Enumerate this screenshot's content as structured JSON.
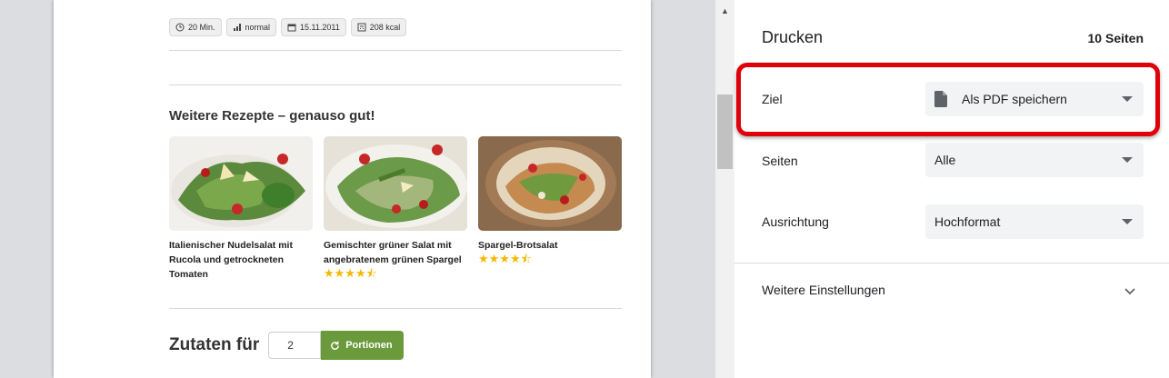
{
  "recipe_page": {
    "meta": [
      {
        "icon": "clock-icon",
        "text": "20 Min."
      },
      {
        "icon": "bars-icon",
        "text": "normal"
      },
      {
        "icon": "calendar-icon",
        "text": "15.11.2011"
      },
      {
        "icon": "calc-icon",
        "text": "208 kcal"
      }
    ],
    "more_recipes_title": "Weitere Rezepte – genauso gut!",
    "recipes": [
      {
        "title": "Italienischer Nudelsalat mit Rucola und getrockneten Tomaten",
        "stars": ""
      },
      {
        "title": "Gemischter grüner Salat mit angebratenem grünen Spargel",
        "stars": "★★★★⯪"
      },
      {
        "title": "Spargel-Brotsalat",
        "stars": "★★★★⯪"
      }
    ],
    "ingredients_label": "Zutaten für",
    "portions_value": "2",
    "portions_button": "Portionen"
  },
  "print_panel": {
    "title": "Drucken",
    "page_count": "10 Seiten",
    "destination_label": "Ziel",
    "destination_value": "Als PDF speichern",
    "pages_label": "Seiten",
    "pages_value": "Alle",
    "orientation_label": "Ausrichtung",
    "orientation_value": "Hochformat",
    "more_settings": "Weitere Einstellungen"
  },
  "colors": {
    "highlight": "#e0000a",
    "button_green": "#6a9a3b",
    "star": "#f5b800"
  }
}
